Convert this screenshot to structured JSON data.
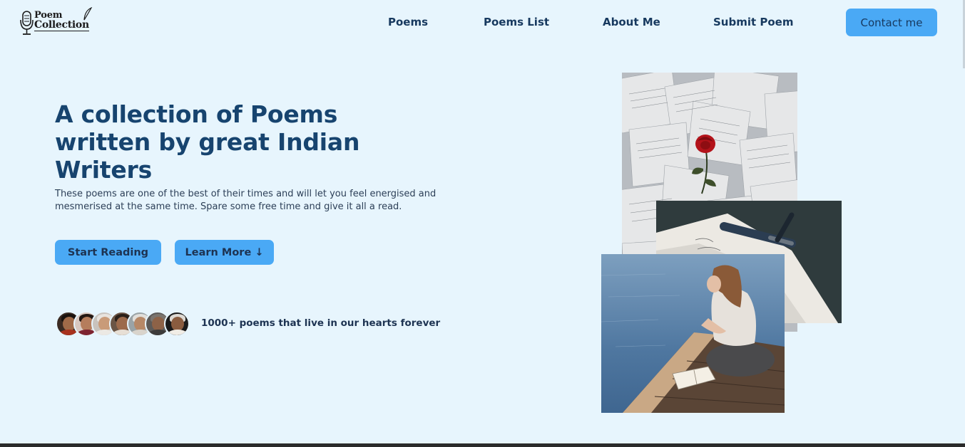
{
  "nav": {
    "logo_line1": "Poem",
    "logo_line2": "Collection",
    "links": [
      "Poems",
      "Poems List",
      "About Me",
      "Submit Poem"
    ],
    "contact_label": "Contact me"
  },
  "hero": {
    "title": "A collection of Poems written by great Indian Writers",
    "description": "These poems are one of the best of their times and will let you feel energised and mesmerised at the same time. Spare some free time and give it all a read.",
    "start_button": "Start Reading",
    "learn_button": "Learn More ↓",
    "avatar_count": 7,
    "avatar_caption": "1000+ poems that live in our hearts forever"
  },
  "collage": {
    "photos": [
      "papers-rose-photo",
      "pen-letter-photo",
      "girl-reading-photo"
    ]
  },
  "colors": {
    "background": "#e7f5fd",
    "accent": "#4aa9f5",
    "heading": "#17446f"
  }
}
